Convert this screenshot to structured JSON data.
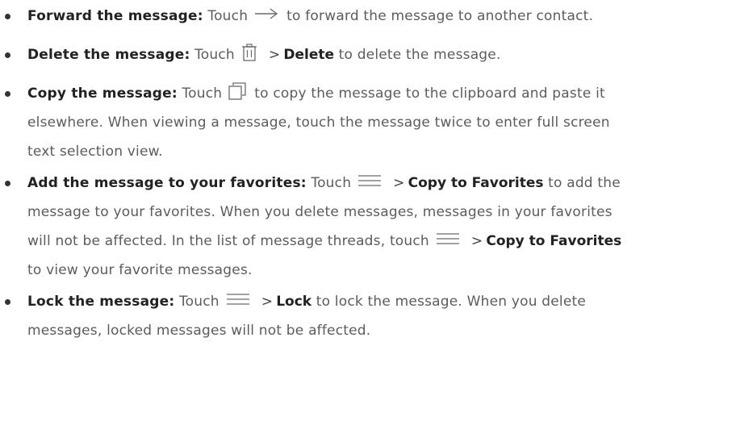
{
  "items": [
    {
      "term": "Forward the message:",
      "lines": [
        {
          "before": "Touch",
          "icon": "arrow-right-icon",
          "after": "to forward the message to another contact."
        }
      ]
    },
    {
      "term": "Delete the message:",
      "lines": [
        {
          "before": "Touch",
          "icon": "trash-icon",
          "bold": "Delete",
          "after": "to delete the message."
        }
      ]
    },
    {
      "term": "Copy the message:",
      "lines": [
        {
          "before": "Touch",
          "icon": "copy-icon",
          "after": "to copy the message to the clipboard and paste it"
        },
        {
          "text": "elsewhere. When viewing a message, touch the message twice to enter full screen"
        },
        {
          "text": "text selection view."
        }
      ]
    },
    {
      "term": "Add the message to your favorites:",
      "lines": [
        {
          "before": "Touch",
          "icon": "menu-icon",
          "bold": "Copy to Favorites",
          "after": "to add the"
        },
        {
          "text": "message to your favorites. When you delete messages, messages in your favorites"
        },
        {
          "before": "will not be affected. In the list of message threads, touch",
          "icon": "menu-icon",
          "bold": "Copy to Favorites"
        },
        {
          "text": "to view your favorite messages."
        }
      ]
    },
    {
      "term": "Lock the message:",
      "lines": [
        {
          "before": "Touch",
          "icon": "menu-icon",
          "bold": "Lock",
          "after": "to lock the message. When you delete"
        },
        {
          "text": "messages, locked messages will not be affected."
        }
      ]
    }
  ],
  "gt_symbol": ">"
}
